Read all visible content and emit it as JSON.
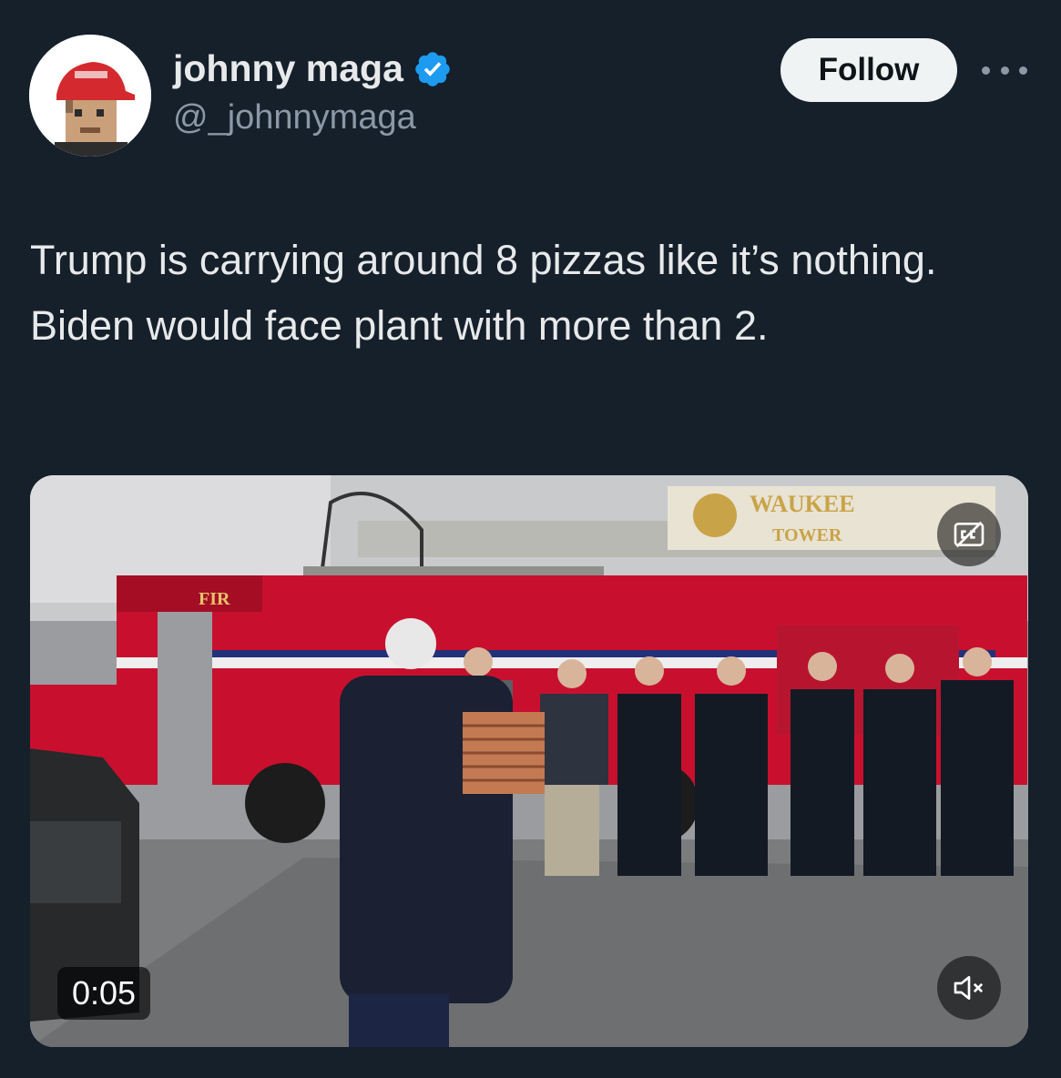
{
  "author": {
    "name": "johnny maga",
    "handle": "@_johnnymaga",
    "avatar_icon": "pixel-avatar-red-cap",
    "verified_icon": "verified-badge-icon",
    "verified_color": "#1d9bf0"
  },
  "follow_label": "Follow",
  "more_icon": "more-options-icon",
  "tweet_text": "Trump is carrying around 8 pizzas like it’s nothing. Biden would face plant with more than 2.",
  "video": {
    "timestamp": "0:05",
    "cc_icon": "closed-captions-icon",
    "mute_icon": "muted-speaker-icon",
    "truck_text_top": "WAUKEE",
    "truck_text_bottom": "TOWER",
    "truck_side_text": "FIR"
  },
  "colors": {
    "background": "#15202b",
    "text_primary": "#e7e9ea",
    "text_secondary": "#8b98a5",
    "follow_bg": "#eff3f4",
    "truck_red": "#c8102e"
  }
}
